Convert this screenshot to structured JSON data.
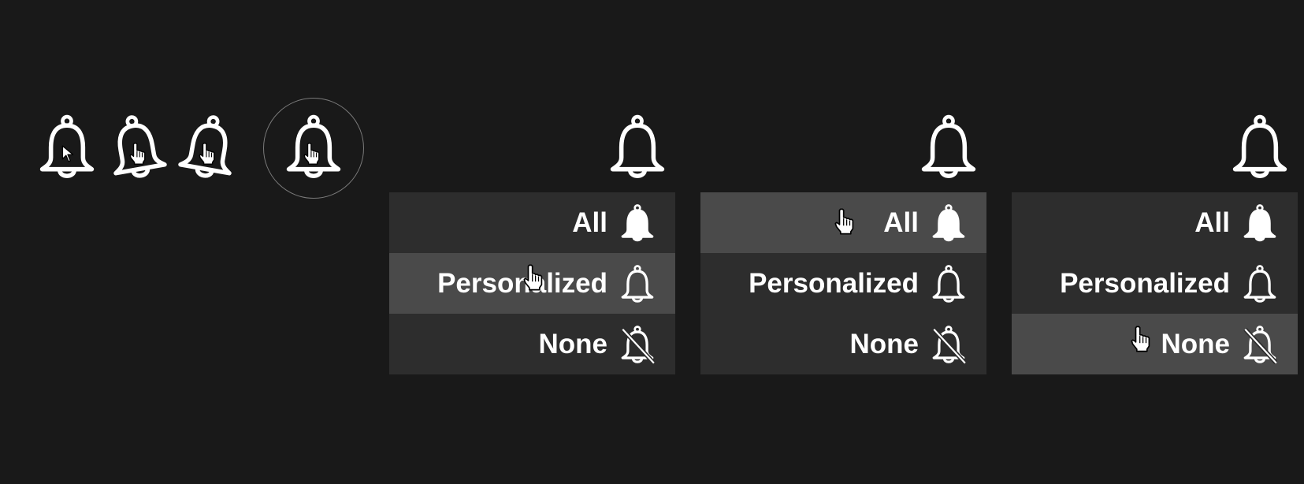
{
  "palette": {
    "background": "#191919",
    "menu_item": "#2d2d2d",
    "menu_item_highlight": "#4a4a4a",
    "foreground": "#ffffff"
  },
  "menus": [
    {
      "highlighted": "personalized",
      "items": [
        {
          "key": "all",
          "label": "All",
          "icon": "bell-filled-icon"
        },
        {
          "key": "personalized",
          "label": "Personalized",
          "icon": "bell-outline-icon"
        },
        {
          "key": "none",
          "label": "None",
          "icon": "bell-off-icon"
        }
      ]
    },
    {
      "highlighted": "all",
      "items": [
        {
          "key": "all",
          "label": "All",
          "icon": "bell-filled-icon"
        },
        {
          "key": "personalized",
          "label": "Personalized",
          "icon": "bell-outline-icon"
        },
        {
          "key": "none",
          "label": "None",
          "icon": "bell-off-icon"
        }
      ]
    },
    {
      "highlighted": "none",
      "items": [
        {
          "key": "all",
          "label": "All",
          "icon": "bell-filled-icon"
        },
        {
          "key": "personalized",
          "label": "Personalized",
          "icon": "bell-outline-icon"
        },
        {
          "key": "none",
          "label": "None",
          "icon": "bell-off-icon"
        }
      ]
    }
  ]
}
